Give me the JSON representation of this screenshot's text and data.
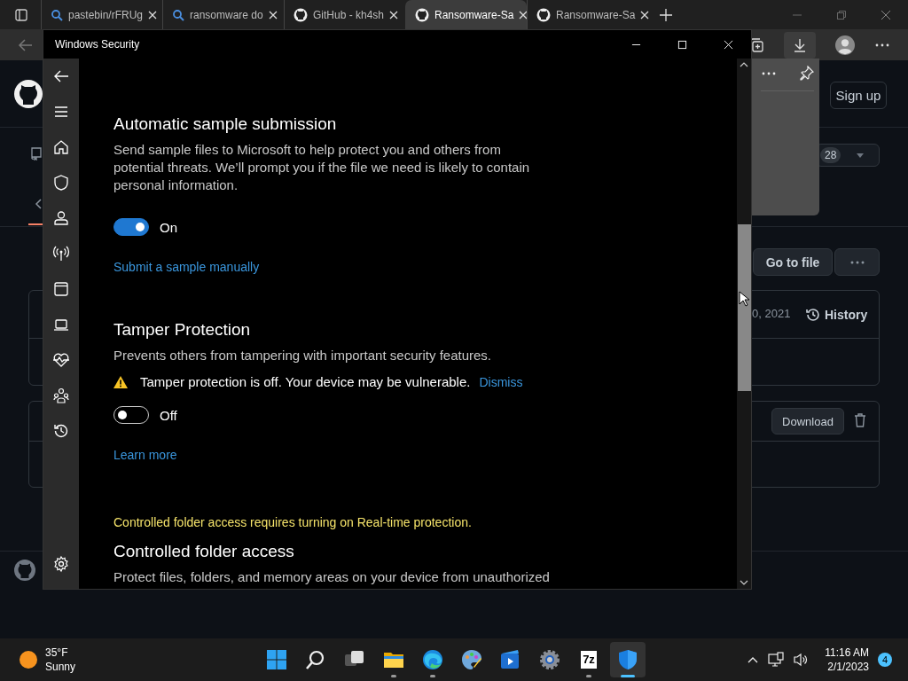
{
  "browser": {
    "tabs": [
      {
        "label": "pastebin/rFRUg",
        "selected": false
      },
      {
        "label": "ransomware do",
        "selected": false
      },
      {
        "label": "GitHub - kh4sh",
        "selected": false
      },
      {
        "label": "Ransomware-Sa",
        "selected": true
      },
      {
        "label": "Ransomware-Sa",
        "selected": false
      }
    ]
  },
  "page": {
    "sign_up": "Sign up",
    "count": "28",
    "go_to_file": "Go to file",
    "date": "0, 2021",
    "history": "History",
    "download": "Download"
  },
  "security_window": {
    "title": "Windows Security",
    "sections": [
      {
        "kind": "heading",
        "text": "Automatic sample submission"
      },
      {
        "kind": "paragraph",
        "text": "Send sample files to Microsoft to help protect you and others from potential threats. We’ll prompt you if the file we need is likely to contain personal information."
      },
      {
        "kind": "toggle",
        "on": true,
        "label": "On"
      },
      {
        "kind": "link",
        "text": "Submit a sample manually"
      },
      {
        "kind": "heading",
        "text": "Tamper Protection"
      },
      {
        "kind": "paragraph",
        "text": "Prevents others from tampering with important security features."
      },
      {
        "kind": "warning",
        "text": "Tamper protection is off. Your device may be vulnerable.",
        "action": "Dismiss"
      },
      {
        "kind": "toggle",
        "on": false,
        "label": "Off"
      },
      {
        "kind": "link",
        "text": "Learn more"
      },
      {
        "kind": "notice",
        "text": "Controlled folder access requires turning on Real-time protection."
      },
      {
        "kind": "heading",
        "text": "Controlled folder access"
      },
      {
        "kind": "paragraph",
        "text": "Protect files, folders, and memory areas on your device from unauthorized"
      }
    ]
  },
  "taskbar": {
    "weather": {
      "temp": "35°F",
      "condition": "Sunny"
    },
    "apps": [
      {
        "kind": "start",
        "running": false,
        "selected": false
      },
      {
        "kind": "search",
        "running": false,
        "selected": false
      },
      {
        "kind": "taskview",
        "running": false,
        "selected": false
      },
      {
        "kind": "explorer",
        "running": true,
        "selected": false
      },
      {
        "kind": "edge",
        "running": true,
        "selected": false
      },
      {
        "kind": "paint",
        "running": false,
        "selected": false
      },
      {
        "kind": "video",
        "running": false,
        "selected": false
      },
      {
        "kind": "settings",
        "running": false,
        "selected": false
      },
      {
        "kind": "archiver",
        "label": "7z",
        "running": true,
        "selected": false
      },
      {
        "kind": "security",
        "running": true,
        "selected": true
      }
    ],
    "time": "11:16 AM",
    "date": "2/1/2023",
    "notifications": "4"
  }
}
